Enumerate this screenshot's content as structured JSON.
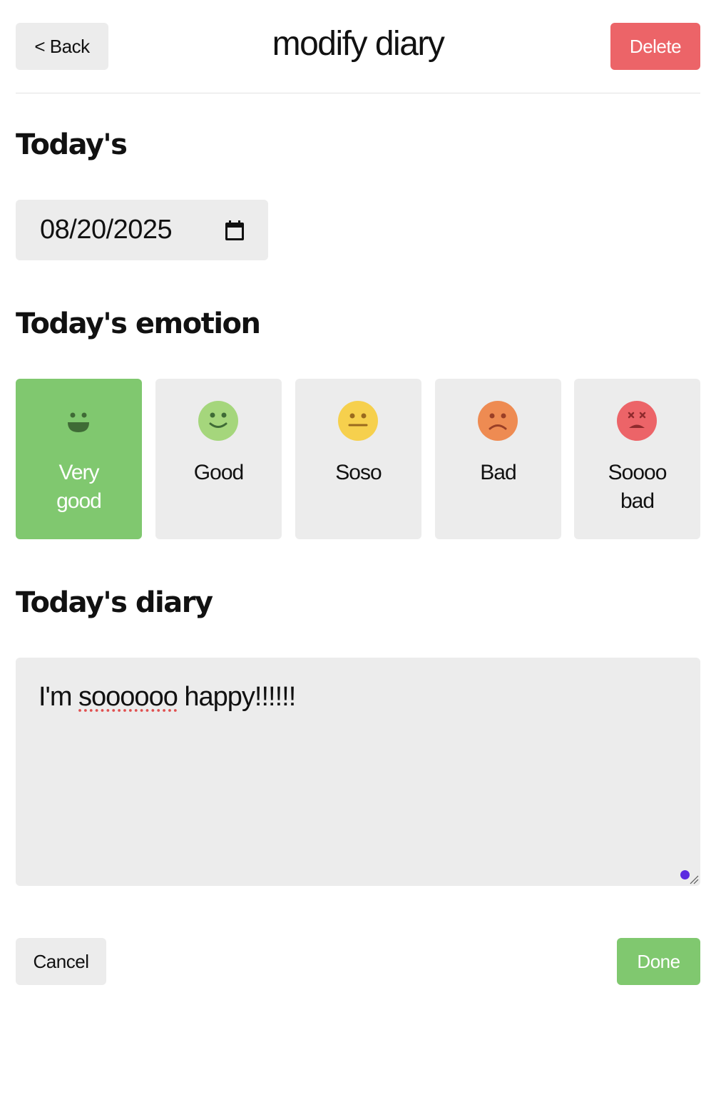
{
  "header": {
    "back_label": "< Back",
    "title": "modify diary",
    "delete_label": "Delete"
  },
  "date_section": {
    "heading": "Today's",
    "date_value": "08/20/2025",
    "icon": "calendar-icon"
  },
  "emotion_section": {
    "heading": "Today's emotion",
    "selected": "Very good",
    "items": [
      {
        "label": "Very good",
        "icon": "very-good-face-icon",
        "color": "#80c86f",
        "selected": true
      },
      {
        "label": "Good",
        "icon": "good-face-icon",
        "color": "#a5d67c",
        "selected": false
      },
      {
        "label": "Soso",
        "icon": "soso-face-icon",
        "color": "#f6d04d",
        "selected": false
      },
      {
        "label": "Bad",
        "icon": "bad-face-icon",
        "color": "#ee8b52",
        "selected": false
      },
      {
        "label": "Soooo bad",
        "icon": "very-bad-face-icon",
        "color": "#ec6468",
        "selected": false
      }
    ]
  },
  "diary_section": {
    "heading": "Today's diary",
    "text_prefix": "I'm ",
    "text_misspelled": "soooooo",
    "text_suffix": " happy!!!!!!"
  },
  "footer": {
    "cancel_label": "Cancel",
    "done_label": "Done"
  },
  "colors": {
    "accent_green": "#80c86f",
    "danger_red": "#ec6468",
    "surface_grey": "#ececec"
  }
}
